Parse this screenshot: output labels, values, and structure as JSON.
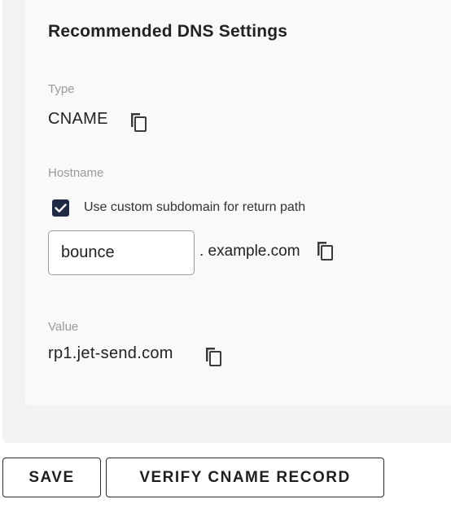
{
  "dns_settings": {
    "title": "Recommended DNS Settings",
    "type_label": "Type",
    "type_value": "CNAME",
    "hostname_label": "Hostname",
    "custom_subdomain_checkbox_label": "Use custom subdomain for return path",
    "custom_subdomain_checked": true,
    "subdomain_input_value": "bounce",
    "domain_suffix": ". example.com",
    "value_label": "Value",
    "value_value": "rp1.jet-send.com"
  },
  "actions": {
    "save_label": "SAVE",
    "verify_label": "VERIFY CNAME RECORD"
  },
  "icons": {
    "copy": "copy-icon",
    "checkbox": "checkmark-icon"
  },
  "colors": {
    "checkbox_fill": "#1f2a44",
    "muted_label": "#9a9a9a",
    "panel_bg": "#f2f2f2",
    "card_bg": "#f9f9f9"
  }
}
